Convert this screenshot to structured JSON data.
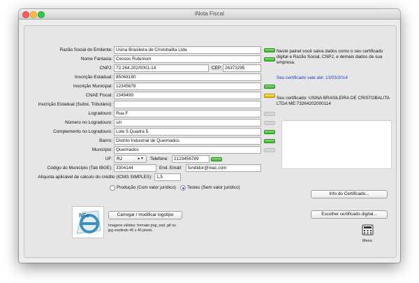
{
  "window": {
    "title": "iNota Fiscal"
  },
  "form": {
    "razao_social": {
      "label": "Razão Social do Emitente:",
      "value": "Usina Brasileira de Cristobalita Ltda"
    },
    "nome_fantasia": {
      "label": "Nome Fantasia:",
      "value": "Cessos Rutenium"
    },
    "cnpj": {
      "label": "CNPJ:",
      "value": "73.264.202/0001-14"
    },
    "cep": {
      "label": "CEP:",
      "value": "26373295"
    },
    "inscricao_estadual": {
      "label": "Inscrição Estadual:",
      "value": "85068180"
    },
    "inscricao_municipal": {
      "label": "Inscrição Municipal:",
      "value": "12345678"
    },
    "cnae_fiscal": {
      "label": "CNAE Fiscal:",
      "value": "2349499"
    },
    "inscricao_estadual_st": {
      "label": "Inscrição Estadual (Subst. Tributário):",
      "value": ""
    },
    "logradouro": {
      "label": "Logradouro:",
      "value": "Rua F"
    },
    "numero": {
      "label": "Número no Logradouro:",
      "value": "s/n"
    },
    "complemento": {
      "label": "Complemento no Logradouro:",
      "value": "Lote 5 Quadra 5"
    },
    "bairro": {
      "label": "Bairro:",
      "value": "Distrito Industrial de Queimados"
    },
    "municipio": {
      "label": "Município:",
      "value": "Queimados"
    },
    "uf": {
      "label": "UF:",
      "value": "RJ"
    },
    "telefone": {
      "label": "Telefone:",
      "value": "2123456789"
    },
    "codigo_municipio": {
      "label": "Código do Município (Tab IBGE):",
      "value": "3304144"
    },
    "email": {
      "label": "End. Email:",
      "value": "fundidor@mac.com"
    },
    "aliquota": {
      "label": "Alíquota aplicável de cálculo do crédito (ICMS SIMPLES):",
      "value": "1,5"
    },
    "ambiente": {
      "producao_label": "Produção (Com valor jurídico)",
      "testes_label": "Testes (Sem valor jurídico)",
      "selected": "testes"
    }
  },
  "info": {
    "description": "Neste painel você salva dados como o seu certificado digital e Razão Social, CNPJ, e demais dados de sua empresa.",
    "validity": "Seu certificado vale até: 13/03/2014",
    "certificate": "Seu certificado: USINA BRASILEIRA DE CRISTOBALITA LTDA ME:73264202000114"
  },
  "buttons": {
    "info_certificado": "Info do Certificado...",
    "escolher_certificado": "Escolher certificado digital...",
    "carregar_logo": "Carregar / modificar logotipo"
  },
  "logo": {
    "note": "Imagens válidas: formato png, psd, gif ou jpg medindo 45 x 45 pixels",
    "letters": "NFe"
  },
  "menu": {
    "label": "Menu",
    "icon": "menu-calculator-icon"
  },
  "indicators": {
    "razao_social": "green",
    "nome_fantasia": "green",
    "inscricao_municipal": "green",
    "cnae_fiscal": "yellow",
    "logradouro": "grey",
    "numero": "grey",
    "complemento": "green",
    "bairro": "green",
    "municipio": "grey",
    "telefone": "green"
  },
  "colors": {
    "accent_blue": "#1d3cd6",
    "ok_green": "#3db22e",
    "warn_yellow": "#e6b400"
  }
}
